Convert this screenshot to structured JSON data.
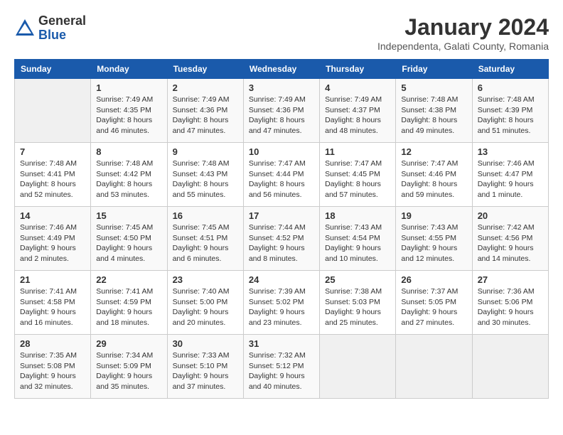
{
  "logo": {
    "general": "General",
    "blue": "Blue"
  },
  "title": "January 2024",
  "location": "Independenta, Galati County, Romania",
  "columns": [
    "Sunday",
    "Monday",
    "Tuesday",
    "Wednesday",
    "Thursday",
    "Friday",
    "Saturday"
  ],
  "weeks": [
    [
      {
        "day": "",
        "info": ""
      },
      {
        "day": "1",
        "info": "Sunrise: 7:49 AM\nSunset: 4:35 PM\nDaylight: 8 hours\nand 46 minutes."
      },
      {
        "day": "2",
        "info": "Sunrise: 7:49 AM\nSunset: 4:36 PM\nDaylight: 8 hours\nand 47 minutes."
      },
      {
        "day": "3",
        "info": "Sunrise: 7:49 AM\nSunset: 4:36 PM\nDaylight: 8 hours\nand 47 minutes."
      },
      {
        "day": "4",
        "info": "Sunrise: 7:49 AM\nSunset: 4:37 PM\nDaylight: 8 hours\nand 48 minutes."
      },
      {
        "day": "5",
        "info": "Sunrise: 7:48 AM\nSunset: 4:38 PM\nDaylight: 8 hours\nand 49 minutes."
      },
      {
        "day": "6",
        "info": "Sunrise: 7:48 AM\nSunset: 4:39 PM\nDaylight: 8 hours\nand 51 minutes."
      }
    ],
    [
      {
        "day": "7",
        "info": "Sunrise: 7:48 AM\nSunset: 4:41 PM\nDaylight: 8 hours\nand 52 minutes."
      },
      {
        "day": "8",
        "info": "Sunrise: 7:48 AM\nSunset: 4:42 PM\nDaylight: 8 hours\nand 53 minutes."
      },
      {
        "day": "9",
        "info": "Sunrise: 7:48 AM\nSunset: 4:43 PM\nDaylight: 8 hours\nand 55 minutes."
      },
      {
        "day": "10",
        "info": "Sunrise: 7:47 AM\nSunset: 4:44 PM\nDaylight: 8 hours\nand 56 minutes."
      },
      {
        "day": "11",
        "info": "Sunrise: 7:47 AM\nSunset: 4:45 PM\nDaylight: 8 hours\nand 57 minutes."
      },
      {
        "day": "12",
        "info": "Sunrise: 7:47 AM\nSunset: 4:46 PM\nDaylight: 8 hours\nand 59 minutes."
      },
      {
        "day": "13",
        "info": "Sunrise: 7:46 AM\nSunset: 4:47 PM\nDaylight: 9 hours\nand 1 minute."
      }
    ],
    [
      {
        "day": "14",
        "info": "Sunrise: 7:46 AM\nSunset: 4:49 PM\nDaylight: 9 hours\nand 2 minutes."
      },
      {
        "day": "15",
        "info": "Sunrise: 7:45 AM\nSunset: 4:50 PM\nDaylight: 9 hours\nand 4 minutes."
      },
      {
        "day": "16",
        "info": "Sunrise: 7:45 AM\nSunset: 4:51 PM\nDaylight: 9 hours\nand 6 minutes."
      },
      {
        "day": "17",
        "info": "Sunrise: 7:44 AM\nSunset: 4:52 PM\nDaylight: 9 hours\nand 8 minutes."
      },
      {
        "day": "18",
        "info": "Sunrise: 7:43 AM\nSunset: 4:54 PM\nDaylight: 9 hours\nand 10 minutes."
      },
      {
        "day": "19",
        "info": "Sunrise: 7:43 AM\nSunset: 4:55 PM\nDaylight: 9 hours\nand 12 minutes."
      },
      {
        "day": "20",
        "info": "Sunrise: 7:42 AM\nSunset: 4:56 PM\nDaylight: 9 hours\nand 14 minutes."
      }
    ],
    [
      {
        "day": "21",
        "info": "Sunrise: 7:41 AM\nSunset: 4:58 PM\nDaylight: 9 hours\nand 16 minutes."
      },
      {
        "day": "22",
        "info": "Sunrise: 7:41 AM\nSunset: 4:59 PM\nDaylight: 9 hours\nand 18 minutes."
      },
      {
        "day": "23",
        "info": "Sunrise: 7:40 AM\nSunset: 5:00 PM\nDaylight: 9 hours\nand 20 minutes."
      },
      {
        "day": "24",
        "info": "Sunrise: 7:39 AM\nSunset: 5:02 PM\nDaylight: 9 hours\nand 23 minutes."
      },
      {
        "day": "25",
        "info": "Sunrise: 7:38 AM\nSunset: 5:03 PM\nDaylight: 9 hours\nand 25 minutes."
      },
      {
        "day": "26",
        "info": "Sunrise: 7:37 AM\nSunset: 5:05 PM\nDaylight: 9 hours\nand 27 minutes."
      },
      {
        "day": "27",
        "info": "Sunrise: 7:36 AM\nSunset: 5:06 PM\nDaylight: 9 hours\nand 30 minutes."
      }
    ],
    [
      {
        "day": "28",
        "info": "Sunrise: 7:35 AM\nSunset: 5:08 PM\nDaylight: 9 hours\nand 32 minutes."
      },
      {
        "day": "29",
        "info": "Sunrise: 7:34 AM\nSunset: 5:09 PM\nDaylight: 9 hours\nand 35 minutes."
      },
      {
        "day": "30",
        "info": "Sunrise: 7:33 AM\nSunset: 5:10 PM\nDaylight: 9 hours\nand 37 minutes."
      },
      {
        "day": "31",
        "info": "Sunrise: 7:32 AM\nSunset: 5:12 PM\nDaylight: 9 hours\nand 40 minutes."
      },
      {
        "day": "",
        "info": ""
      },
      {
        "day": "",
        "info": ""
      },
      {
        "day": "",
        "info": ""
      }
    ]
  ]
}
